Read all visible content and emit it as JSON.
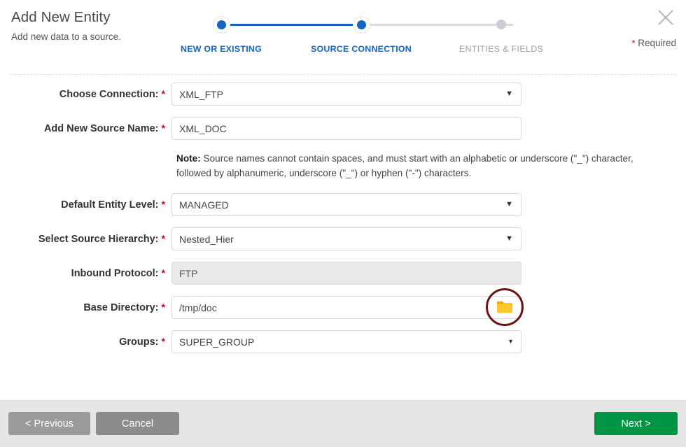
{
  "header": {
    "title": "Add New Entity",
    "subtitle": "Add new data to a source.",
    "required_asterisk": "*",
    "required_label": "Required",
    "close_icon": "close-icon"
  },
  "stepper": {
    "steps": [
      {
        "label": "NEW OR EXISTING",
        "state": "complete"
      },
      {
        "label": "SOURCE CONNECTION",
        "state": "active"
      },
      {
        "label": "ENTITIES & FIELDS",
        "state": "inactive"
      }
    ],
    "active_color": "#1565c0",
    "inactive_color": "#c9ced6"
  },
  "form": {
    "asterisk": "*",
    "fields": [
      {
        "label": "Choose Connection:",
        "value": "XML_FTP",
        "type": "select",
        "caret": "▼"
      },
      {
        "label": "Add New Source Name:",
        "value": "XML_DOC",
        "type": "text"
      },
      {
        "label": "Default Entity Level:",
        "value": "MANAGED",
        "type": "select",
        "caret": "▼"
      },
      {
        "label": "Select Source Hierarchy:",
        "value": "Nested_Hier",
        "type": "select",
        "caret": "▼"
      },
      {
        "label": "Inbound Protocol:",
        "value": "FTP",
        "type": "text-disabled"
      },
      {
        "label": "Base Directory:",
        "value": "/tmp/doc",
        "type": "text-with-browse",
        "browse_icon": "folder-icon"
      },
      {
        "label": "Groups:",
        "value": "SUPER_GROUP",
        "type": "multiselect",
        "caret": "▼"
      }
    ],
    "note": {
      "prefix": "Note:",
      "text": " Source names cannot contain spaces, and must start with an alphabetic or underscore (\"_\") character, followed by alphanumeric, underscore (\"_\") or hyphen (\"-\") characters."
    }
  },
  "footer": {
    "previous_label": "< Previous",
    "cancel_label": "Cancel",
    "next_label": "Next >",
    "next_color": "#009544"
  }
}
